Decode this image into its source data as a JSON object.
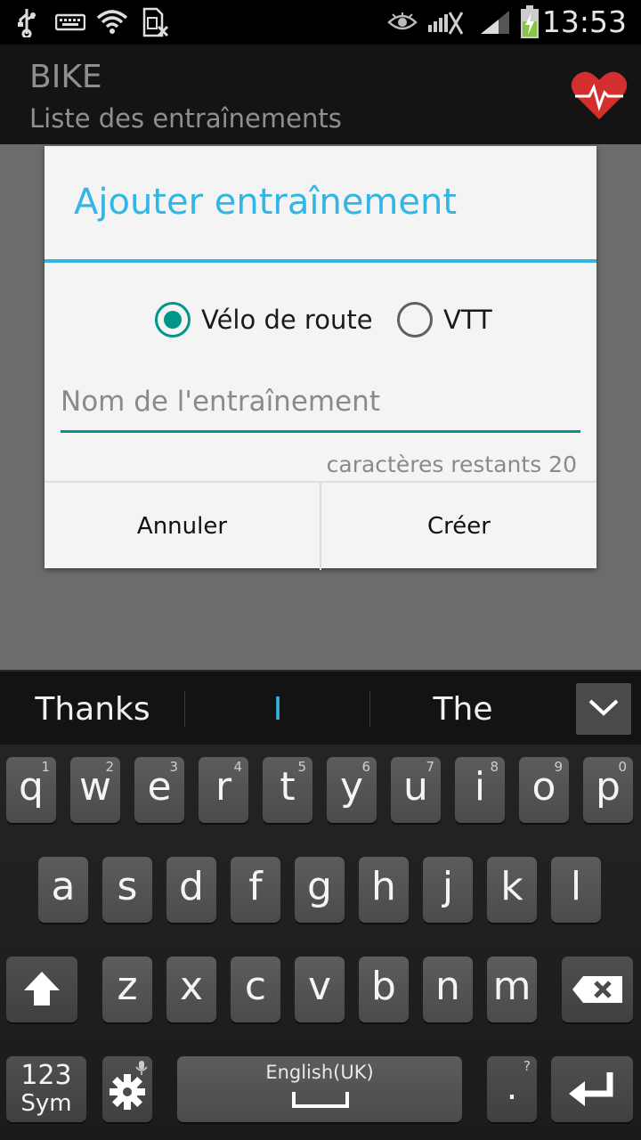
{
  "status_bar": {
    "time": "13:53",
    "icons": [
      "usb-icon",
      "keyboard-icon",
      "wifi-icon",
      "sim-icon",
      "eye-icon",
      "no-signal-icon",
      "signal-icon",
      "battery-charging-icon"
    ]
  },
  "action_bar": {
    "title": "BIKE",
    "subtitle": "Liste des entraînements",
    "logo_icon": "heart-pulse-icon"
  },
  "dialog": {
    "title": "Ajouter entraînement",
    "radio_options": [
      {
        "label": "Vélo de route",
        "checked": true
      },
      {
        "label": "VTT",
        "checked": false
      }
    ],
    "name_placeholder": "Nom de l'entraînement",
    "name_value": "",
    "remaining_chars": "caractères restants 20",
    "cancel_label": "Annuler",
    "create_label": "Créer"
  },
  "keyboard": {
    "suggestions": [
      "Thanks",
      "I",
      "The"
    ],
    "row1": [
      {
        "k": "q",
        "h": "1"
      },
      {
        "k": "w",
        "h": "2"
      },
      {
        "k": "e",
        "h": "3"
      },
      {
        "k": "r",
        "h": "4"
      },
      {
        "k": "t",
        "h": "5"
      },
      {
        "k": "y",
        "h": "6"
      },
      {
        "k": "u",
        "h": "7"
      },
      {
        "k": "i",
        "h": "8"
      },
      {
        "k": "o",
        "h": "9"
      },
      {
        "k": "p",
        "h": "0"
      }
    ],
    "row2": [
      "a",
      "s",
      "d",
      "f",
      "g",
      "h",
      "j",
      "k",
      "l"
    ],
    "row3": [
      "z",
      "x",
      "c",
      "v",
      "b",
      "n",
      "m"
    ],
    "sym_label_1": "123",
    "sym_label_2": "Sym",
    "space_label": "English(UK)",
    "period_label": ".",
    "period_hint": "?"
  },
  "colors": {
    "accent_blue": "#33b5e5",
    "accent_teal": "#009688",
    "heart_red": "#d32f2f"
  }
}
